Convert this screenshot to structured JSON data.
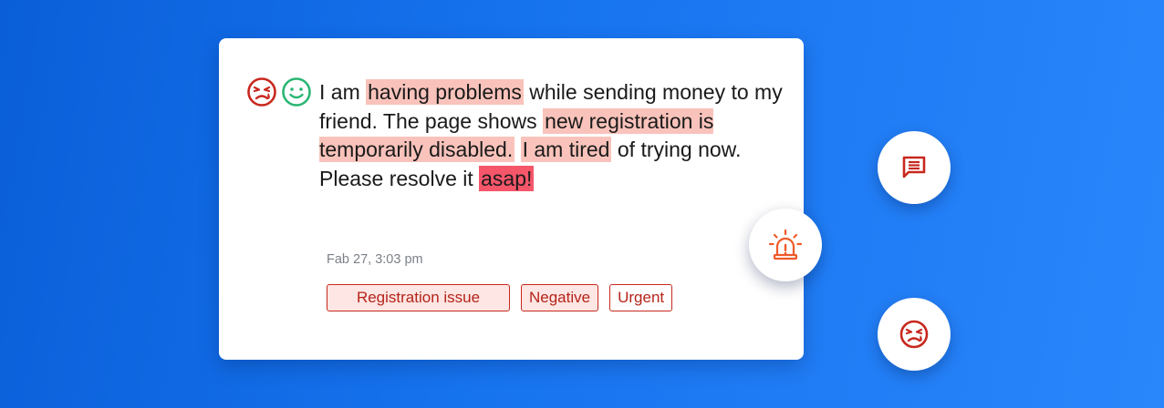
{
  "message": {
    "parts": [
      {
        "text": " I am ",
        "hl": "none"
      },
      {
        "text": "having problems",
        "hl": "soft"
      },
      {
        "text": " while sending money to my friend. The page shows ",
        "hl": "none"
      },
      {
        "text": "new registration is temporarily disabled.",
        "hl": "soft"
      },
      {
        "text": " ",
        "hl": "none"
      },
      {
        "text": "I am tired",
        "hl": "soft"
      },
      {
        "text": " of trying now. Please resolve it ",
        "hl": "none"
      },
      {
        "text": "asap!",
        "hl": "strong"
      }
    ]
  },
  "timestamp": "Fab 27, 3:03 pm",
  "tags": [
    "Registration issue",
    "Negative",
    "Urgent"
  ],
  "icons": {
    "sentiment_negative": "frustrated-face-icon",
    "sentiment_positive": "smiley-face-icon",
    "comment": "comment-icon",
    "urgent": "alarm-siren-icon",
    "negative": "frustrated-face-icon"
  },
  "colors": {
    "accent_red": "#c8281e",
    "highlight_soft": "#f9c3bb",
    "highlight_strong": "#f5566a",
    "positive_green": "#2bb673",
    "siren_orange": "#f05a28"
  }
}
